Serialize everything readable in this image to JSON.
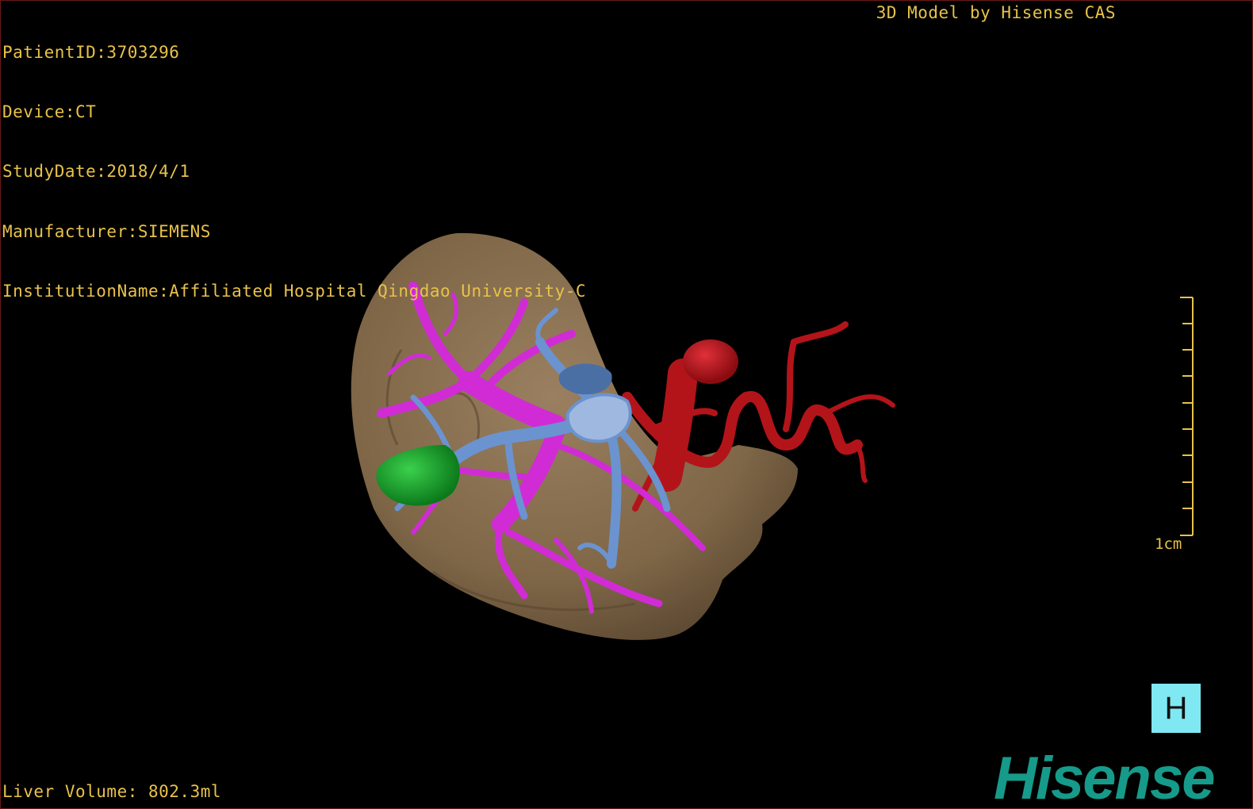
{
  "overlay": {
    "info_lines": [
      "PatientID:3703296",
      "Device:CT",
      "StudyDate:2018/4/1",
      "Manufacturer:SIEMENS",
      "InstitutionName:Affiliated Hospital Qingdao University-C"
    ],
    "credit": "3D Model by Hisense CAS",
    "volume": "Liver Volume: 802.3ml",
    "text_color": "#e8c24a"
  },
  "scale_bar": {
    "label": "1cm"
  },
  "orientation_marker": {
    "label": "H",
    "color": "#7fe8f2"
  },
  "brand": {
    "logo_text": "Hisense",
    "color": "#169a8a"
  },
  "model": {
    "structures": [
      {
        "name": "liver",
        "color": "#8a7150"
      },
      {
        "name": "portal-vein",
        "color": "#d12bd6"
      },
      {
        "name": "hepatic-vein",
        "color": "#6b93cf"
      },
      {
        "name": "hepatic-artery",
        "color": "#b3141a"
      },
      {
        "name": "lesion",
        "color": "#17a32a"
      }
    ]
  }
}
